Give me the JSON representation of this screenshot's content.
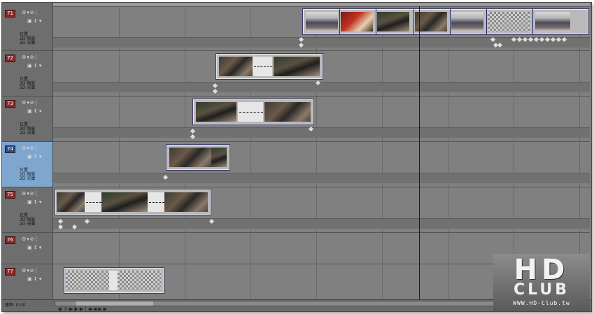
{
  "tracks": [
    {
      "number": "71",
      "selected": false
    },
    {
      "number": "72",
      "selected": false
    },
    {
      "number": "73",
      "selected": false
    },
    {
      "number": "74",
      "selected": true
    },
    {
      "number": "75",
      "selected": false
    },
    {
      "number": "76",
      "selected": false
    },
    {
      "number": "77",
      "selected": false
    }
  ],
  "envelope_labels": {
    "position": "位置",
    "shadow": "2D 陰影",
    "glow": "2D 光暈"
  },
  "status": {
    "rate_label": "速率: 0.00"
  },
  "watermark": {
    "line1": "HD",
    "line2": "CLUB",
    "url": "WWW.HD-Club.tw"
  },
  "colors": {
    "selected_track": "#7fa6cf",
    "track_number_bg": "#8a2b2b",
    "timeline_bg": "#808080"
  }
}
